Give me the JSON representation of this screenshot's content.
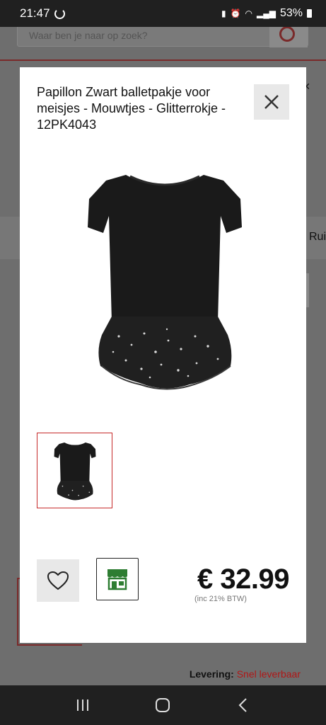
{
  "status_bar": {
    "time": "21:47",
    "battery": "53%"
  },
  "background": {
    "search_placeholder": "Waar ben je naar op zoek?",
    "right_cut_text": "Rui",
    "delivery_label": "Levering:",
    "delivery_value": "Snel leverbaar"
  },
  "modal": {
    "title": "Papillon Zwart balletpakje voor meisjes - Mouwtjes - Glitterrokje - 12PK4043",
    "price": "€ 32.99",
    "vat_note": "(inc 21% BTW)"
  },
  "colors": {
    "accent": "#c62828",
    "store_icon": "#2e7d32",
    "dress": "#1a1a1a"
  },
  "icons": {
    "close": "close-icon",
    "wishlist": "heart-icon",
    "store": "store-icon",
    "recents": "recents-icon",
    "home": "home-icon",
    "back": "back-icon"
  }
}
